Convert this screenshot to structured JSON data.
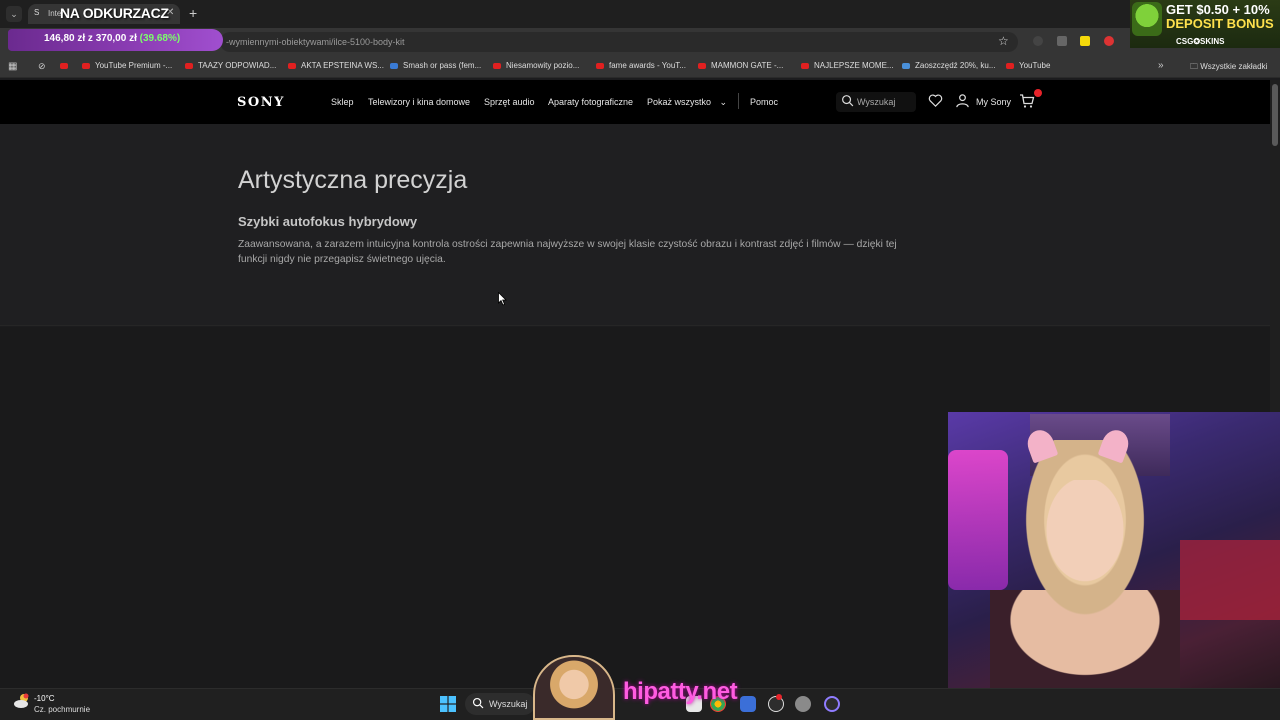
{
  "browser": {
    "tab_title": "Inte",
    "tab_favicon": "S",
    "stream_title": "NA ODKURZACZ",
    "url": "-wymiennymi-obiektywami/ilce-5100-body-kit",
    "price_banner": {
      "price": "146,80 zł z 370,00 zł",
      "percent": "(39.68%)"
    },
    "bookmarks": [
      "YouTube Premium -...",
      "TAAZY ODPOWIAD...",
      "AKTA EPSTEINA WS...",
      "Smash or pass (fem...",
      "Niesamowity pozio...",
      "fame awards - YouT...",
      "MAMMON GATE -...",
      "NAJLEPSZE MOME...",
      "Zaoszczędź 20%, ku...",
      "YouTube"
    ],
    "all_bookmarks": "Wszystkie zakładki"
  },
  "ad": {
    "line1": "GET $0.50 + 10%",
    "line2": "DEPOSIT BONUS",
    "brand": "CSG✪SKINS"
  },
  "sony": {
    "logo": "SONY",
    "nav": [
      "Sklep",
      "Telewizory i kina domowe",
      "Sprzęt audio",
      "Aparaty fotograficzne",
      "Pokaż wszystko"
    ],
    "help": "Pomoc",
    "search_placeholder": "Wyszukaj",
    "my_sony": "My Sony",
    "accent": "#e8232a"
  },
  "content": {
    "heading": "Artystyczna precyzja",
    "subheading": "Szybki autofokus hybrydowy",
    "description": "Zaawansowana, a zarazem intuicyjna kontrola ostrości zapewnia najwyższe w swojej klasie czystość obrazu i kontrast zdjęć i filmów — dzięki tej funkcji nigdy nie przegapisz świetnego ujęcia."
  },
  "taskbar": {
    "temperature": "-10°C",
    "weather": "Cz. pochmurnie",
    "search": "Wyszukaj"
  },
  "overlay": {
    "watermark": "hipatty.net"
  }
}
